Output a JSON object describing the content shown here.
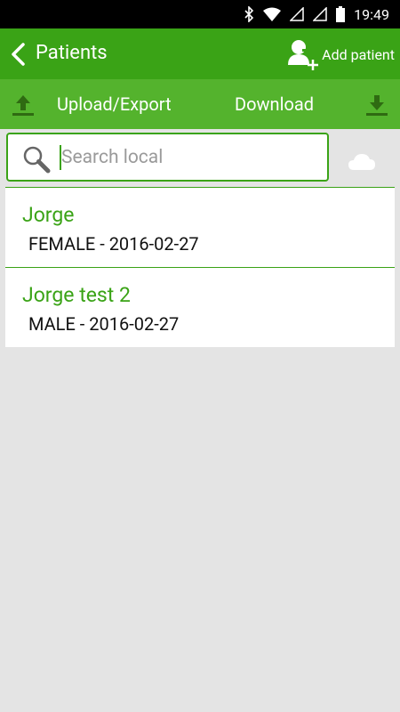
{
  "status_bar": {
    "time": "19:49"
  },
  "app_bar": {
    "title": "Patients",
    "add_patient_label": "Add patient"
  },
  "sync_bar": {
    "upload_label": "Upload/Export",
    "download_label": "Download"
  },
  "search": {
    "placeholder": "Search local",
    "value": ""
  },
  "patients": [
    {
      "name": "Jorge",
      "info": "FEMALE - 2016-02-27"
    },
    {
      "name": "Jorge test 2",
      "info": "MALE - 2016-02-27"
    }
  ],
  "colors": {
    "primary": "#3aa316",
    "secondary": "#54b32d",
    "background": "#e4e4e4"
  },
  "icons": [
    "bluetooth-icon",
    "wifi-icon",
    "signal-icon",
    "battery-icon",
    "back-arrow-icon",
    "add-user-icon",
    "upload-icon",
    "download-icon",
    "search-icon",
    "cloud-icon"
  ]
}
